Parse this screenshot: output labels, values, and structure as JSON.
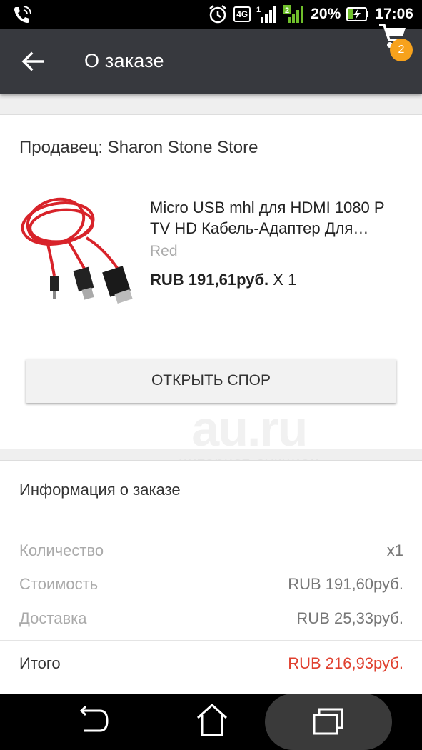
{
  "status_bar": {
    "network": "4G",
    "sim1": "1",
    "sim2": "2",
    "battery": "20%",
    "time": "17:06"
  },
  "app_bar": {
    "title": "О заказе",
    "cart_count": "2"
  },
  "seller": {
    "label": "Продавец: Sharon Stone Store"
  },
  "product": {
    "title": "Micro USB mhl для HDMI 1080 P TV HD Кабель-Адаптер Для Samsung Galaxy",
    "variant": "Red",
    "price": "RUB 191,61руб.",
    "quantity": "X 1"
  },
  "actions": {
    "open_dispute": "ОТКРЫТЬ СПОР"
  },
  "watermark": {
    "logo": "au.ru",
    "tagline": "интернет-аукцион"
  },
  "order_info": {
    "header": "Информация о заказе",
    "rows": [
      {
        "label": "Количество",
        "value": "x1"
      },
      {
        "label": "Стоимость",
        "value": "RUB 191,60руб."
      },
      {
        "label": "Доставка",
        "value": "RUB 25,33руб."
      }
    ],
    "total": {
      "label": "Итого",
      "value": "RUB 216,93руб."
    }
  },
  "colors": {
    "app_bar": "#37393e",
    "badge": "#f7a21c",
    "total_value": "#e0402f"
  }
}
